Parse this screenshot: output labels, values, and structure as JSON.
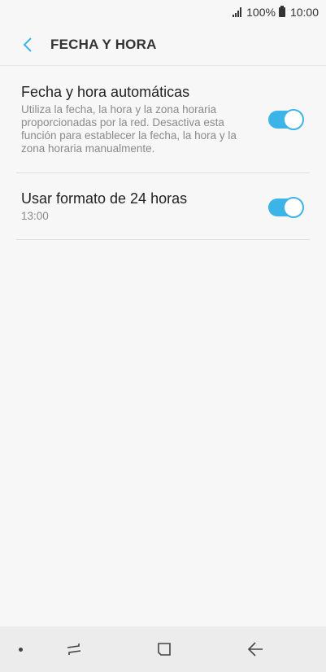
{
  "status_bar": {
    "battery_percent": "100%",
    "time": "10:00",
    "icons": [
      "signal-icon",
      "battery-icon"
    ]
  },
  "header": {
    "title": "FECHA Y HORA",
    "back_icon": "chevron-left-icon",
    "accent_color": "#3db4e8"
  },
  "settings": [
    {
      "title": "Fecha y hora automáticas",
      "description": "Utiliza la fecha, la hora y la zona horaria proporcionadas por la red. Desactiva esta función para establecer la fecha, la hora y la zona horaria manualmente.",
      "enabled": true
    },
    {
      "title": "Usar formato de 24 horas",
      "description": "13:00",
      "enabled": true
    }
  ],
  "nav_bar": {
    "icons": [
      "dot-icon",
      "recents-icon",
      "home-icon",
      "back-arrow-icon"
    ]
  }
}
